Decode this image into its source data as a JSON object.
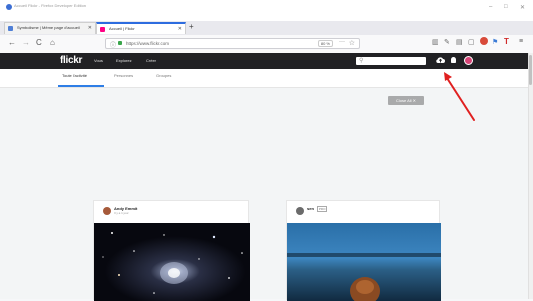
{
  "window": {
    "title": "Accueil Flickr - Firefox Developer Edition",
    "min": "–",
    "max": "□",
    "close": "✕"
  },
  "tabs": [
    {
      "label": "Symbolisme | Même page d'accueil",
      "close": "✕"
    },
    {
      "label": "Accueil | Flickr",
      "close": "✕"
    }
  ],
  "new_tab": "+",
  "nav": {
    "back": "←",
    "forward": "→",
    "reload": "C",
    "home": "⌂",
    "info": "ⓘ",
    "url": "https://www.flickr.com",
    "zoom": "80 %",
    "more": "···",
    "star": "☆"
  },
  "flickr": {
    "logo": "flickr",
    "menu": [
      "Vous",
      "Explorez",
      "Créer"
    ],
    "search_icon": "⚲",
    "upload_icon": "cloud-upload-icon",
    "bell_icon": "bell-icon"
  },
  "subtabs": [
    "Toute l'activité",
    "Personnes",
    "Groupes"
  ],
  "close_all_label": "Close All ✕",
  "cards": [
    {
      "user": "Andy Emmit",
      "meta": "Il y a 1 jour",
      "pro": ""
    },
    {
      "user": "sen",
      "meta": "",
      "pro": "PRO"
    }
  ],
  "colors": {
    "accent": "#2e7ee6",
    "flickr_bar": "#212124",
    "annotation_arrow": "#e02020"
  }
}
